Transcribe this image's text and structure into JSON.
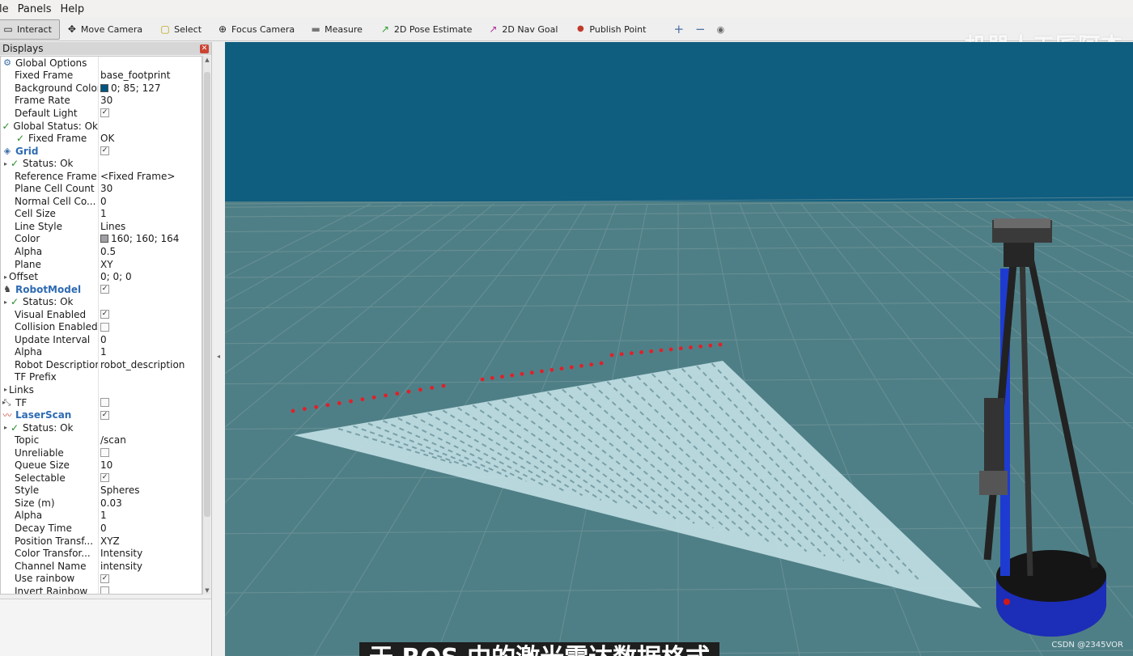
{
  "menubar": {
    "items": [
      "le",
      "Panels",
      "Help"
    ]
  },
  "toolbar": {
    "tools": [
      {
        "label": "Interact",
        "icon": "interact-icon",
        "glyph": "▭"
      },
      {
        "label": "Move Camera",
        "icon": "move-camera-icon",
        "glyph": "✥"
      },
      {
        "label": "Select",
        "icon": "select-icon",
        "glyph": "▢"
      },
      {
        "label": "Focus Camera",
        "icon": "focus-camera-icon",
        "glyph": "⊕"
      },
      {
        "label": "Measure",
        "icon": "measure-icon",
        "glyph": "▬"
      },
      {
        "label": "2D Pose Estimate",
        "icon": "pose-estimate-icon",
        "glyph": "↗"
      },
      {
        "label": "2D Nav Goal",
        "icon": "nav-goal-icon",
        "glyph": "↗"
      },
      {
        "label": "Publish Point",
        "icon": "publish-point-icon",
        "glyph": "●"
      }
    ],
    "extra": {
      "add": "+",
      "remove": "−",
      "view": "◉"
    },
    "watermark": "机器人工匠阿杰"
  },
  "colors": {
    "background": "#005579",
    "grid_floor": "#4f7f86",
    "grid_lines": "#a0a0a4",
    "scan_points": "#e0202a",
    "selected_tool": "#dcdcdc"
  },
  "displays": {
    "title": "Displays",
    "rows": [
      {
        "indent": 0,
        "arrow": "",
        "icon": "gear-icon",
        "glyph": "⚙",
        "label": "Global Options",
        "value": ""
      },
      {
        "indent": 1,
        "label": "Fixed Frame",
        "value": "base_footprint"
      },
      {
        "indent": 1,
        "label": "Background Color",
        "value": "0; 85; 127",
        "swatch": "#00557f"
      },
      {
        "indent": 1,
        "label": "Frame Rate",
        "value": "30"
      },
      {
        "indent": 1,
        "label": "Default Light",
        "check": true
      },
      {
        "indent": 0,
        "check_icon": true,
        "label": "Global Status: Ok",
        "value": ""
      },
      {
        "indent": 1,
        "check_icon": true,
        "label": "Fixed Frame",
        "value": "OK"
      },
      {
        "indent": 0,
        "icon": "grid-icon",
        "glyph": "◈",
        "label": "Grid",
        "title": true,
        "check": true
      },
      {
        "indent": 0,
        "arrow": "▸",
        "check_icon": true,
        "label": "Status: Ok",
        "value": "",
        "sub": true
      },
      {
        "indent": 1,
        "label": "Reference Frame",
        "value": "<Fixed Frame>"
      },
      {
        "indent": 1,
        "label": "Plane Cell Count",
        "value": "30"
      },
      {
        "indent": 1,
        "label": "Normal Cell Co...",
        "value": "0"
      },
      {
        "indent": 1,
        "label": "Cell Size",
        "value": "1"
      },
      {
        "indent": 1,
        "label": "Line Style",
        "value": "Lines"
      },
      {
        "indent": 1,
        "label": "Color",
        "value": "160; 160; 164",
        "swatch": "#a0a0a4"
      },
      {
        "indent": 1,
        "label": "Alpha",
        "value": "0.5"
      },
      {
        "indent": 1,
        "label": "Plane",
        "value": "XY"
      },
      {
        "indent": 0,
        "arrow": "▸",
        "label": "Offset",
        "value": "0; 0; 0",
        "sub": true
      },
      {
        "indent": 0,
        "icon": "robot-model-icon",
        "glyph": "♞",
        "label": "RobotModel",
        "title": true,
        "check": true
      },
      {
        "indent": 0,
        "arrow": "▸",
        "check_icon": true,
        "label": "Status: Ok",
        "value": "",
        "sub": true
      },
      {
        "indent": 1,
        "label": "Visual Enabled",
        "check": true
      },
      {
        "indent": 1,
        "label": "Collision Enabled",
        "check": false
      },
      {
        "indent": 1,
        "label": "Update Interval",
        "value": "0"
      },
      {
        "indent": 1,
        "label": "Alpha",
        "value": "1"
      },
      {
        "indent": 1,
        "label": "Robot Description",
        "value": "robot_description"
      },
      {
        "indent": 1,
        "label": "TF Prefix",
        "value": ""
      },
      {
        "indent": 0,
        "arrow": "▸",
        "label": "Links",
        "value": "",
        "sub": true
      },
      {
        "indent": 0,
        "arrow": "▸",
        "icon": "tf-icon",
        "glyph": "⤡",
        "label": "TF",
        "check": false
      },
      {
        "indent": 0,
        "icon": "laser-scan-icon",
        "glyph": "〰",
        "label": "LaserScan",
        "title": true,
        "check": true
      },
      {
        "indent": 0,
        "arrow": "▸",
        "check_icon": true,
        "label": "Status: Ok",
        "value": "",
        "sub": true
      },
      {
        "indent": 1,
        "label": "Topic",
        "value": "/scan"
      },
      {
        "indent": 1,
        "label": "Unreliable",
        "check": false
      },
      {
        "indent": 1,
        "label": "Queue Size",
        "value": "10"
      },
      {
        "indent": 1,
        "label": "Selectable",
        "check": true
      },
      {
        "indent": 1,
        "label": "Style",
        "value": "Spheres"
      },
      {
        "indent": 1,
        "label": "Size (m)",
        "value": "0.03"
      },
      {
        "indent": 1,
        "label": "Alpha",
        "value": "1"
      },
      {
        "indent": 1,
        "label": "Decay Time",
        "value": "0"
      },
      {
        "indent": 1,
        "label": "Position Transf...",
        "value": "XYZ"
      },
      {
        "indent": 1,
        "label": "Color Transfor...",
        "value": "Intensity"
      },
      {
        "indent": 1,
        "label": "Channel Name",
        "value": "intensity"
      },
      {
        "indent": 1,
        "label": "Use rainbow",
        "check": true
      },
      {
        "indent": 1,
        "label": "Invert Rainbow",
        "check": false
      }
    ]
  },
  "viewport": {
    "subtitle": "于 ROS 中的激光雷达数据格式",
    "watermark_small": "CSDN @2345VOR"
  }
}
